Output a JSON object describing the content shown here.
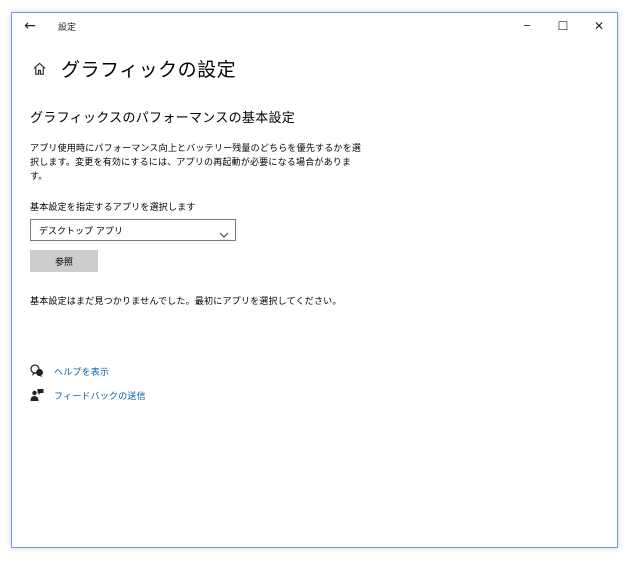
{
  "window": {
    "title": "設定",
    "back_glyph": "←",
    "minimize_glyph": "─",
    "maximize_glyph": "☐",
    "close_glyph": "✕"
  },
  "page": {
    "title": "グラフィックの設定",
    "section_title": "グラフィックスのパフォーマンスの基本設定",
    "description": "アプリ使用時にパフォーマンス向上とバッテリー残量のどちらを優先するかを選択します。変更を有効にするには、アプリの再起動が必要になる場合があります。",
    "select_label": "基本設定を指定するアプリを選択します",
    "dropdown_value": "デスクトップ アプリ",
    "browse_label": "参照",
    "empty_message": "基本設定はまだ見つかりませんでした。最初にアプリを選択してください。"
  },
  "links": {
    "help": "ヘルプを表示",
    "feedback": "フィードバックの送信"
  },
  "colors": {
    "link": "#0063b1",
    "window_border": "#6b9bd6",
    "button_bg": "#cccccc"
  },
  "icons": {
    "back": "back-arrow-icon",
    "home": "home-icon",
    "chevron": "chevron-down-icon",
    "help": "help-chat-icon",
    "feedback": "feedback-person-icon"
  }
}
